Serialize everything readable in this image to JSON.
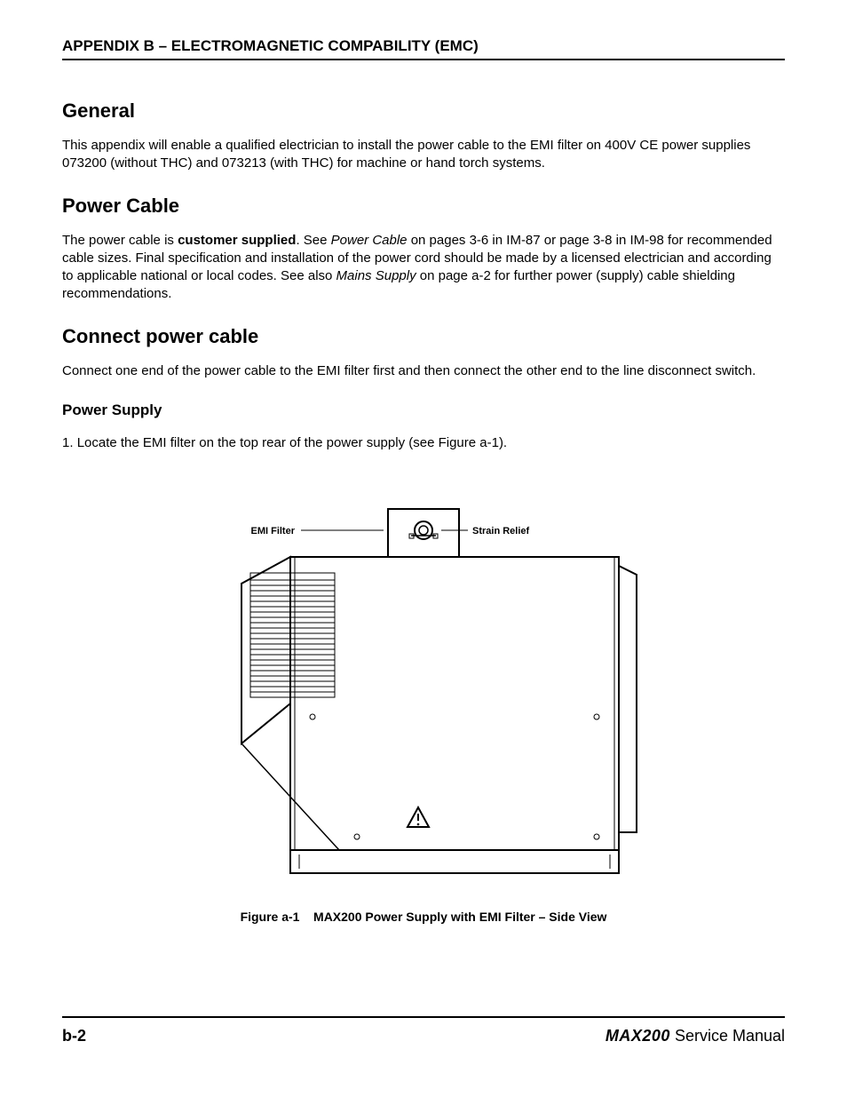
{
  "header": {
    "title": "APPENDIX B – ELECTROMAGNETIC COMPABILITY (EMC)"
  },
  "sections": {
    "general": {
      "heading": "General",
      "body": "This appendix will enable a qualified electrician to install the power cable to the EMI filter on 400V CE power supplies 073200 (without THC) and 073213 (with THC) for machine or hand torch systems."
    },
    "power_cable": {
      "heading": "Power Cable",
      "body_pre": "The power cable is ",
      "body_bold": "customer supplied",
      "body_mid1": ". See ",
      "body_em1": "Power Cable",
      "body_mid2": " on pages 3-6 in IM-87 or page 3-8 in IM-98 for recommended cable sizes. Final specification and installation of the power cord should be made by a licensed electrician and according to applicable national or local codes. See also ",
      "body_em2": "Mains Supply",
      "body_post": " on page a-2 for further power (supply) cable shielding recommendations."
    },
    "connect": {
      "heading": "Connect power cable",
      "body": "Connect one end of the power cable to the EMI filter first and then connect the other end to the line disconnect switch."
    },
    "power_supply": {
      "heading": "Power Supply",
      "step1": "Locate the EMI filter on the top rear of the power supply (see Figure a-1)."
    }
  },
  "figure": {
    "label_emi": "EMI Filter",
    "label_strain": "Strain Relief",
    "caption_prefix": "Figure a-1",
    "caption_text": "MAX200 Power Supply with EMI Filter – Side View"
  },
  "footer": {
    "left": "b-2",
    "brand": "MAX200",
    "right": "  Service Manual"
  }
}
